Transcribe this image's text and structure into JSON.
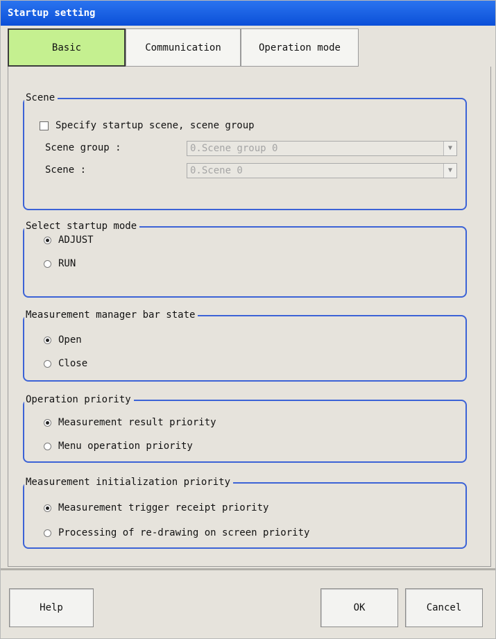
{
  "window": {
    "title": "Startup setting"
  },
  "tabs": [
    {
      "label": "Basic",
      "active": true
    },
    {
      "label": "Communication",
      "active": false
    },
    {
      "label": "Operation mode",
      "active": false
    }
  ],
  "scene_group": {
    "legend": "Scene",
    "checkbox_label": "Specify startup scene, scene group",
    "checkbox_checked": false,
    "scene_group_label": "Scene group :",
    "scene_group_value": "0.Scene group 0",
    "scene_label": "Scene :",
    "scene_value": "0.Scene 0"
  },
  "startup_mode": {
    "legend": "Select startup mode",
    "options": [
      {
        "label": "ADJUST",
        "selected": true
      },
      {
        "label": "RUN",
        "selected": false
      }
    ]
  },
  "manager_bar": {
    "legend": "Measurement manager bar state",
    "options": [
      {
        "label": "Open",
        "selected": true
      },
      {
        "label": "Close",
        "selected": false
      }
    ]
  },
  "operation_priority": {
    "legend": "Operation priority",
    "options": [
      {
        "label": "Measurement result priority",
        "selected": true
      },
      {
        "label": "Menu operation priority",
        "selected": false
      }
    ]
  },
  "init_priority": {
    "legend": "Measurement initialization priority",
    "options": [
      {
        "label": "Measurement trigger receipt priority",
        "selected": true
      },
      {
        "label": "Processing of re-drawing on screen priority",
        "selected": false
      }
    ]
  },
  "buttons": {
    "help": "Help",
    "ok": "OK",
    "cancel": "Cancel"
  },
  "colors": {
    "title_bar": "#0b4fd8",
    "active_tab": "#c5f090",
    "group_border": "#3b62d6"
  }
}
